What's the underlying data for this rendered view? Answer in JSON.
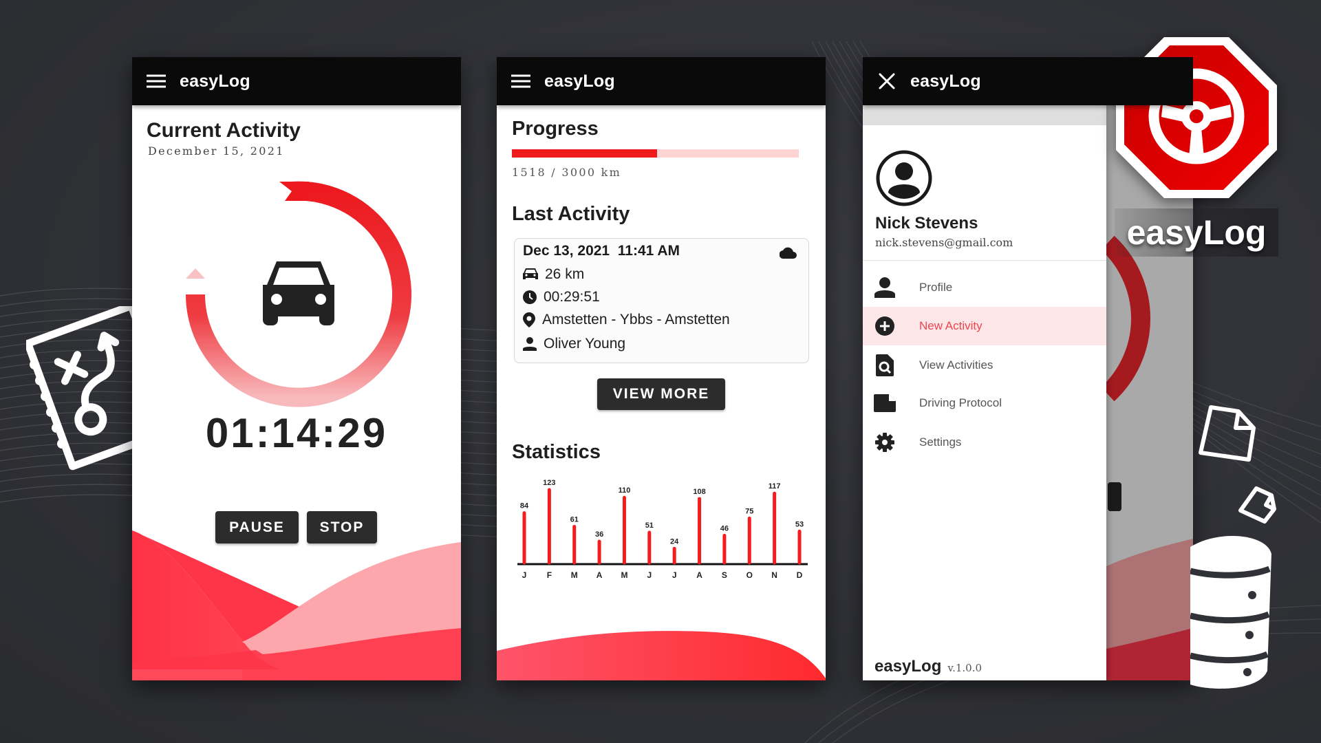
{
  "app": {
    "name": "easyLog",
    "version": "v.1.0.0"
  },
  "colors": {
    "accent": "#ee1a1c",
    "accent_light": "#fdd3d4",
    "appbar": "#0b0a0b",
    "button_dark": "#2c2c2c",
    "active_item_bg": "#fde6e7",
    "active_item_text": "#ec4450"
  },
  "screen_current": {
    "appbar_title": "easyLog",
    "menu_icon": "hamburger-menu-icon",
    "heading": "Current Activity",
    "date": "December 15, 2021",
    "center_icon": "car-icon",
    "timer": "01:14:29",
    "buttons": {
      "pause": "PAUSE",
      "stop": "STOP"
    }
  },
  "screen_dashboard": {
    "appbar_title": "easyLog",
    "progress": {
      "heading": "Progress",
      "current_km": 1518,
      "goal_km": 3000,
      "label": "1518 / 3000 km"
    },
    "last_activity": {
      "heading": "Last Activity",
      "datetime": "Dec 13, 2021  11:41 AM",
      "sync_icon": "cloud-icon",
      "distance": "26 km",
      "duration": "00:29:51",
      "route": "Amstetten - Ybbs - Amstetten",
      "driver": "Oliver Young"
    },
    "view_more_label": "VIEW MORE",
    "statistics_heading": "Statistics"
  },
  "screen_drawer": {
    "appbar_title": "easyLog",
    "close_icon": "close-icon",
    "user": {
      "name": "Nick Stevens",
      "email": "nick.stevens@gmail.com"
    },
    "items": [
      {
        "label": "Profile",
        "icon": "person-icon",
        "active": false
      },
      {
        "label": "New Activity",
        "icon": "add-circle-icon",
        "active": true
      },
      {
        "label": "View Activities",
        "icon": "document-search-icon",
        "active": false
      },
      {
        "label": "Driving Protocol",
        "icon": "document-icon",
        "active": false
      },
      {
        "label": "Settings",
        "icon": "gear-icon",
        "active": false
      }
    ],
    "footer_name": "easyLog",
    "footer_version": "v.1.0.0"
  },
  "brand": {
    "logo_icon": "steering-wheel-icon",
    "label": "easyLog"
  },
  "chart_data": {
    "type": "bar",
    "title": "Statistics",
    "categories": [
      "J",
      "F",
      "M",
      "A",
      "M",
      "J",
      "J",
      "A",
      "S",
      "O",
      "N",
      "D"
    ],
    "values": [
      84,
      123,
      61,
      36,
      110,
      51,
      24,
      108,
      46,
      75,
      117,
      53
    ],
    "xlabel": "",
    "ylabel": "",
    "ylim": [
      0,
      130
    ],
    "grid": false,
    "data_labels": true
  }
}
